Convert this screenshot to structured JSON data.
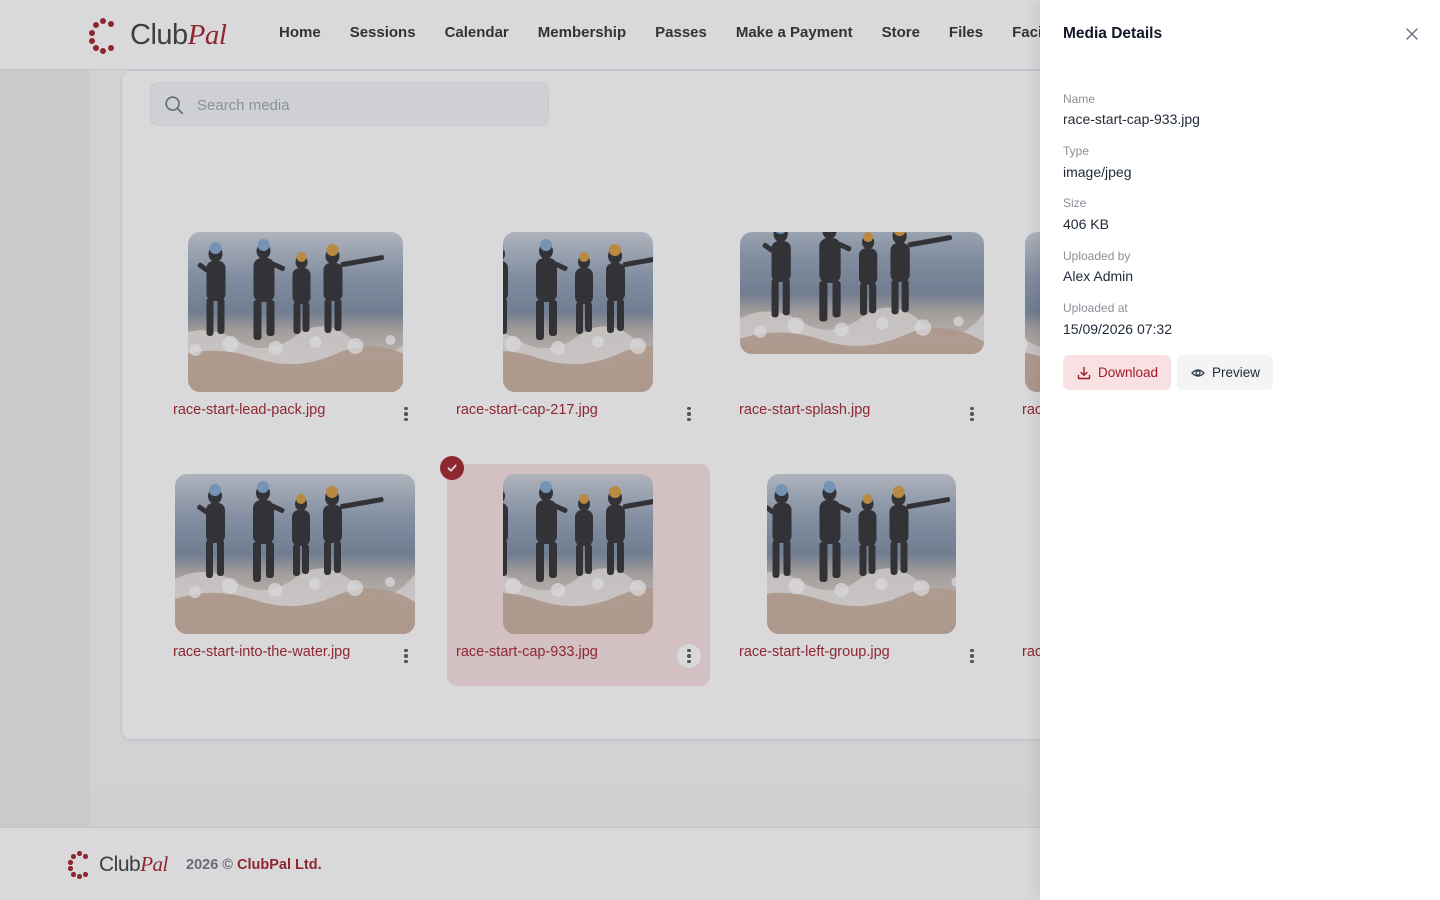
{
  "brand": {
    "name_part1": "Club",
    "name_part2": "Pal",
    "accent": "#9f1c24"
  },
  "nav": {
    "items": [
      "Home",
      "Sessions",
      "Calendar",
      "Membership",
      "Passes",
      "Make a Payment",
      "Store",
      "Files",
      "Facility"
    ]
  },
  "search": {
    "placeholder": "Search media"
  },
  "media": {
    "items": [
      {
        "name": "race-start-lead-pack.jpg",
        "selected": false
      },
      {
        "name": "race-start-cap-217.jpg",
        "selected": false
      },
      {
        "name": "race-start-splash.jpg",
        "selected": false
      },
      {
        "name": "rac",
        "selected": false
      },
      {
        "name": "race-start-into-the-water.jpg",
        "selected": false
      },
      {
        "name": "race-start-cap-933.jpg",
        "selected": true
      },
      {
        "name": "race-start-left-group.jpg",
        "selected": false
      },
      {
        "name": "rac",
        "selected": false
      }
    ]
  },
  "footer": {
    "year_text": "2026 ©",
    "company": "ClubPal Ltd."
  },
  "drawer": {
    "title": "Media Details",
    "fields": [
      {
        "label": "Name",
        "value": "race-start-cap-933.jpg"
      },
      {
        "label": "Type",
        "value": "image/jpeg"
      },
      {
        "label": "Size",
        "value": "406 KB"
      },
      {
        "label": "Uploaded by",
        "value": "Alex Admin"
      },
      {
        "label": "Uploaded at",
        "value": "15/09/2026 07:32"
      }
    ],
    "download_label": "Download",
    "preview_label": "Preview"
  },
  "icons": {
    "search": "search-icon",
    "close": "close-icon",
    "download": "download-icon",
    "preview": "eye-icon",
    "check": "check-icon",
    "more": "more-vertical-icon"
  }
}
